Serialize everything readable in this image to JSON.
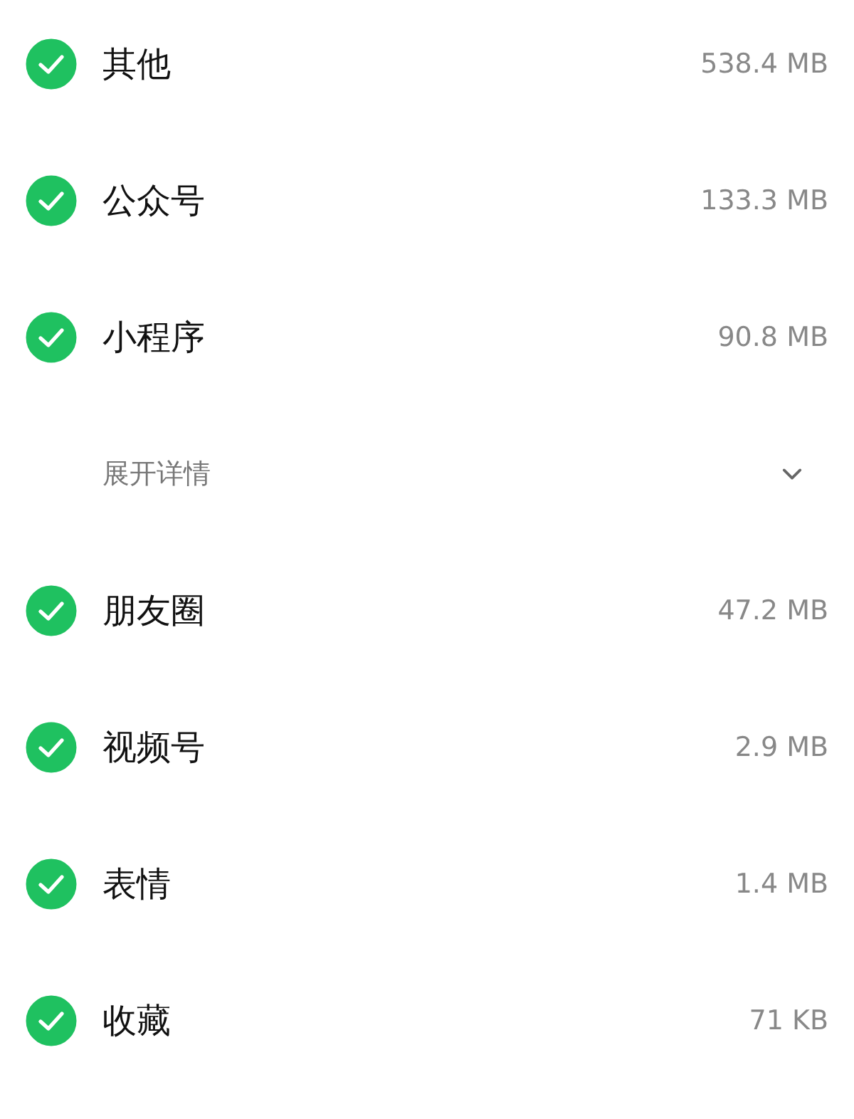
{
  "rows": [
    {
      "kind": "item",
      "label": "其他",
      "size": "538.4 MB",
      "checked": true
    },
    {
      "kind": "item",
      "label": "公众号",
      "size": "133.3 MB",
      "checked": true
    },
    {
      "kind": "item",
      "label": "小程序",
      "size": "90.8 MB",
      "checked": true
    },
    {
      "kind": "expand",
      "label": "展开详情",
      "expanded": false
    },
    {
      "kind": "item",
      "label": "朋友圈",
      "size": "47.2 MB",
      "checked": true
    },
    {
      "kind": "item",
      "label": "视频号",
      "size": "2.9 MB",
      "checked": true
    },
    {
      "kind": "item",
      "label": "表情",
      "size": "1.4 MB",
      "checked": true
    },
    {
      "kind": "item",
      "label": "收藏",
      "size": "71 KB",
      "checked": true
    }
  ]
}
